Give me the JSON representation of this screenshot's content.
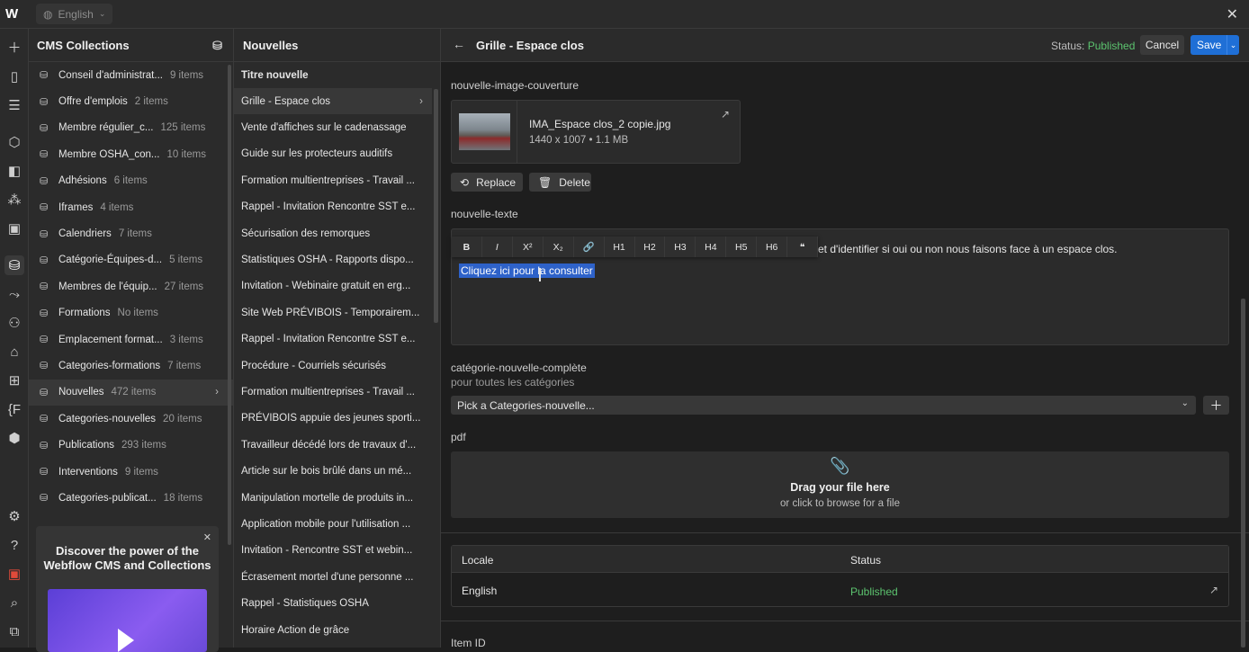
{
  "topbar": {
    "language": "English"
  },
  "collections": {
    "title": "CMS Collections",
    "items": [
      {
        "name": "Conseil d'administrat...",
        "count": "9 items"
      },
      {
        "name": "Offre d'emplois",
        "count": "2 items"
      },
      {
        "name": "Membre régulier_c...",
        "count": "125 items"
      },
      {
        "name": "Membre OSHA_con...",
        "count": "10 items"
      },
      {
        "name": "Adhésions",
        "count": "6 items"
      },
      {
        "name": "Iframes",
        "count": "4 items"
      },
      {
        "name": "Calendriers",
        "count": "7 items"
      },
      {
        "name": "Catégorie-Équipes-d...",
        "count": "5 items"
      },
      {
        "name": "Membres de l'équip...",
        "count": "27 items"
      },
      {
        "name": "Formations",
        "count": "No items"
      },
      {
        "name": "Emplacement format...",
        "count": "3 items"
      },
      {
        "name": "Categories-formations",
        "count": "7 items"
      },
      {
        "name": "Nouvelles",
        "count": "472 items"
      },
      {
        "name": "Categories-nouvelles",
        "count": "20 items"
      },
      {
        "name": "Publications",
        "count": "293 items"
      },
      {
        "name": "Interventions",
        "count": "9 items"
      },
      {
        "name": "Categories-publicat...",
        "count": "18 items"
      }
    ],
    "promo_title": "Discover the power of the Webflow CMS and Collections"
  },
  "items_panel": {
    "title": "Nouvelles",
    "column_header": "Titre nouvelle",
    "items": [
      "Grille - Espace clos",
      "Vente d'affiches sur le cadenassage",
      "Guide sur les protecteurs auditifs",
      "Formation multientreprises - Travail ...",
      "Rappel - Invitation Rencontre SST e...",
      "Sécurisation des remorques",
      "Statistiques OSHA - Rapports dispo...",
      "Invitation - Webinaire gratuit en erg...",
      "Site Web PRÉVIBOIS - Temporairem...",
      "Rappel - Invitation Rencontre SST e...",
      "Procédure - Courriels sécurisés",
      "Formation multientreprises - Travail ...",
      "PRÉVIBOIS appuie des jeunes sporti...",
      "Travailleur décédé lors de travaux d'...",
      "Article sur le bois brûlé dans un mé...",
      "Manipulation mortelle de produits in...",
      "Application mobile pour l'utilisation ...",
      "Invitation - Rencontre SST et webin...",
      "Écrasement mortel d'une personne ...",
      "Rappel - Statistiques OSHA",
      "Horaire Action de grâce"
    ]
  },
  "editor": {
    "title": "Grille - Espace clos",
    "status_label": "Status:",
    "status_value": "Published",
    "cancel": "Cancel",
    "save": "Save",
    "image_field": "nouvelle-image-couverture",
    "image_name": "IMA_Espace clos_2 copie.jpg",
    "image_dims": "1440 x 1007",
    "image_size": "1.1 MB",
    "replace": "Replace",
    "delete": "Delete",
    "text_field": "nouvelle-texte",
    "toolbar": [
      "B",
      "I",
      "X²",
      "X₂",
      "🔗",
      "H1",
      "H2",
      "H3",
      "H4",
      "H5",
      "H6",
      "❝"
    ],
    "text_line1": "et d'identifier si oui ou non nous faisons face à un espace clos.",
    "text_selected": "Cliquez ici pour la consulter",
    "category_field": "catégorie-nouvelle-complète",
    "category_hint": "pour toutes les catégories",
    "category_placeholder": "Pick a Categories-nouvelle...",
    "pdf_field": "pdf",
    "drop_title": "Drag your file here",
    "drop_sub": "or click to browse for a file",
    "locale_header": "Locale",
    "status_header": "Status",
    "locale_value": "English",
    "locale_status": "Published",
    "item_id_label": "Item ID"
  }
}
